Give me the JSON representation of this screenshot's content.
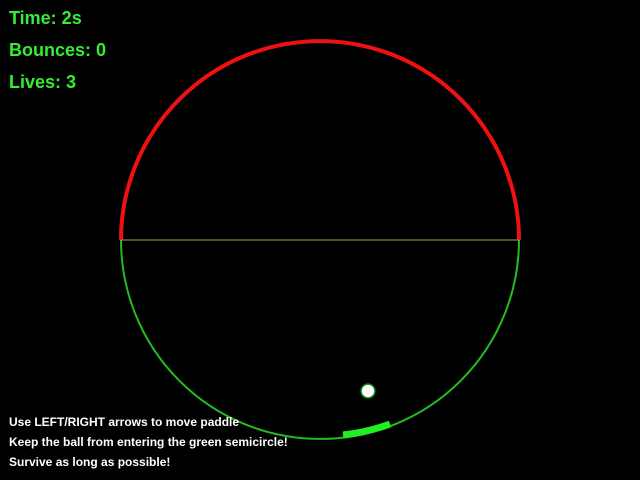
{
  "hud": {
    "time_label": "Time: 2s",
    "bounces_label": "Bounces: 0",
    "lives_label": "Lives: 3"
  },
  "instructions": [
    "Use LEFT/RIGHT arrows to move paddle",
    "Keep the ball from entering the green semicircle!",
    "Survive as long as possible!"
  ],
  "colors": {
    "background": "#000000",
    "text": "#33ee33",
    "instruction_text": "#ffffff",
    "safe_arc": "#ee1111",
    "danger_arc": "#22bb22",
    "divider": "#b8a020",
    "paddle": "#22ee22",
    "ball_fill": "#ffffff",
    "ball_stroke": "#0b7a0b"
  },
  "game": {
    "time_seconds": 2,
    "bounces": 0,
    "lives": 3
  }
}
